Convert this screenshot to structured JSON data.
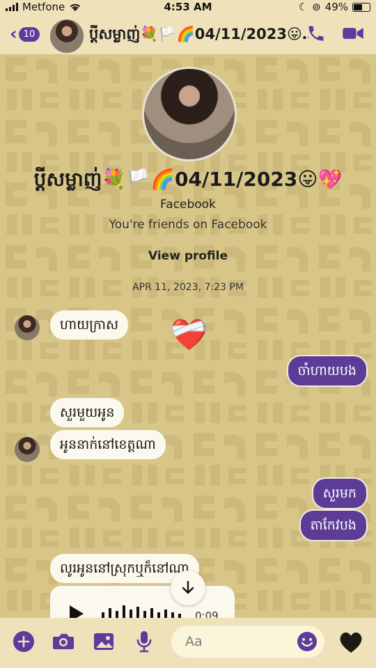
{
  "status_bar": {
    "carrier": "Metfone",
    "time": "4:53 AM",
    "battery": "49%"
  },
  "header": {
    "back_count": "10",
    "contact_name": "ប្តីសម្លាញ់💐🏳️‍🌈04/11/2023😛…",
    "icons": [
      "back-chevron-icon",
      "phone-icon",
      "video-camera-icon"
    ]
  },
  "profile": {
    "name": "ប្តីសម្លាញ់💐🏳️‍🌈04/11/2023😛💖",
    "source": "Facebook",
    "friends_text": "You're friends on Facebook",
    "view_profile_label": "View profile",
    "date_stamp": "APR 11, 2023, 7:23 PM"
  },
  "messages": [
    {
      "direction": "in",
      "text": "ហាយក្រាស"
    },
    {
      "direction": "in",
      "text": "❤️‍🩹"
    },
    {
      "direction": "out",
      "text": "ចាំហាយបង"
    },
    {
      "direction": "in",
      "text": "សួរមួយអូន"
    },
    {
      "direction": "in",
      "text": "អូននាក់នៅខេត្តណា"
    },
    {
      "direction": "out",
      "text": "សួរមក"
    },
    {
      "direction": "out",
      "text": "តាកែវបង"
    },
    {
      "direction": "in",
      "text": "លូរអូននៅស្រុកឬក៏នៅណា"
    },
    {
      "direction": "in",
      "type": "voice",
      "duration": "0:09"
    }
  ],
  "composer": {
    "placeholder": "Aa",
    "icons": [
      "plus-icon",
      "camera-icon",
      "gallery-icon",
      "microphone-icon",
      "emoji-icon",
      "heart-icon"
    ]
  },
  "colors": {
    "accent": "#5c3c96",
    "background": "#d8c689",
    "bar": "#efe2bb"
  }
}
